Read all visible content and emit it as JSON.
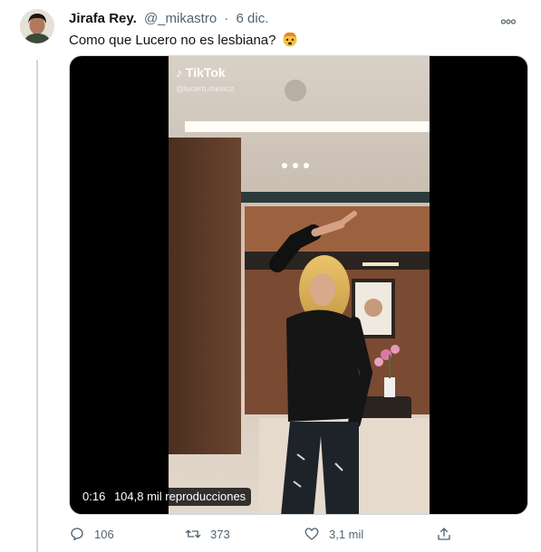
{
  "tweet": {
    "author_name": "Jirafa Rey.",
    "author_handle": "@_mikastro",
    "separator": "·",
    "date": "6 dic.",
    "more_icon": "more-horizontal-icon",
    "text": "Como que Lucero no es lesbiana?",
    "emoji": "exploding-head-emoji"
  },
  "media": {
    "tiktok_brand": "TikTok",
    "tiktok_user": "@lucero.mexico",
    "duration": "0:16",
    "views": "104,8 mil reproducciones"
  },
  "actions": {
    "reply_count": "106",
    "retweet_count": "373",
    "like_count": "3,1 mil",
    "reply_icon": "reply-icon",
    "retweet_icon": "retweet-icon",
    "like_icon": "heart-icon",
    "share_icon": "share-icon"
  },
  "colors": {
    "text": "#0f1419",
    "secondary": "#536471",
    "thread_line": "#cfd9de"
  }
}
